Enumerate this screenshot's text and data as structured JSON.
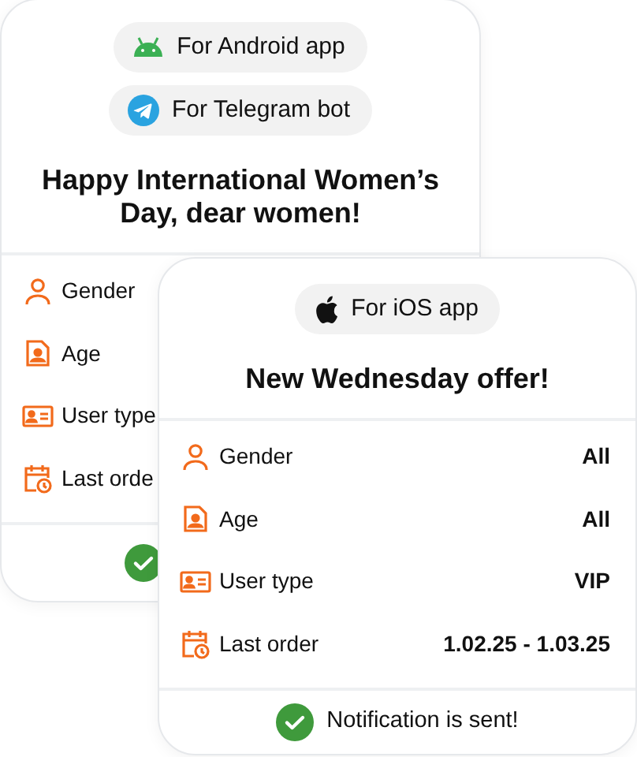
{
  "cards": [
    {
      "platforms": [
        {
          "kind": "android",
          "label": "For Android app"
        },
        {
          "kind": "telegram",
          "label": "For Telegram bot"
        }
      ],
      "title": "Happy International Women’s Day, dear women!",
      "filters": [
        {
          "kind": "gender",
          "label": "Gender"
        },
        {
          "kind": "age",
          "label": "Age"
        },
        {
          "kind": "usertype",
          "label": "User type"
        },
        {
          "kind": "lastorder",
          "label": "Last orde"
        }
      ],
      "status": {
        "sent": true
      }
    },
    {
      "platforms": [
        {
          "kind": "ios",
          "label": "For iOS app"
        }
      ],
      "title": "New Wednesday offer!",
      "filters": [
        {
          "kind": "gender",
          "label": "Gender",
          "value": "All"
        },
        {
          "kind": "age",
          "label": "Age",
          "value": "All"
        },
        {
          "kind": "usertype",
          "label": "User type",
          "value": "VIP"
        },
        {
          "kind": "lastorder",
          "label": "Last order",
          "value": "1.02.25 - 1.03.25"
        }
      ],
      "status": {
        "sent": true,
        "text": "Notification is sent!"
      }
    }
  ]
}
